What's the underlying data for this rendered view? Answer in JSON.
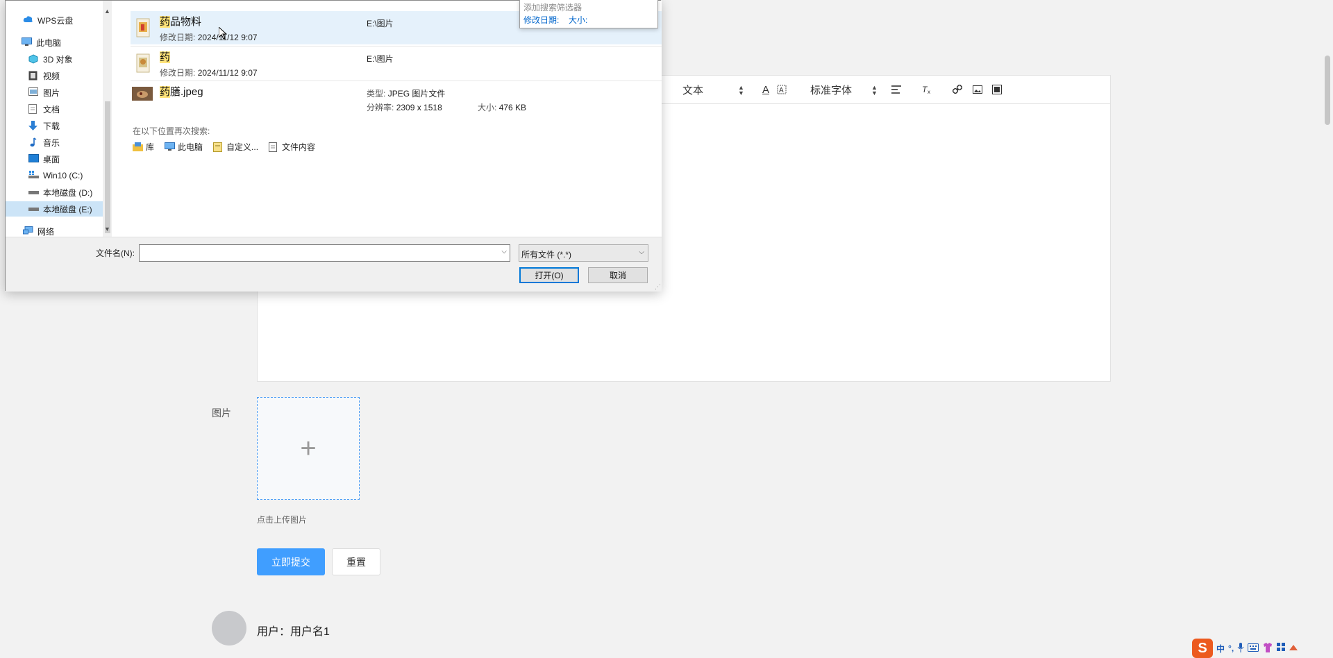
{
  "editor": {
    "toolbar": {
      "text_style": "文本",
      "font_color_icon": "A",
      "font_family": "标准字体"
    }
  },
  "form": {
    "image_label": "图片",
    "upload_plus": "+",
    "upload_hint": "点击上传图片",
    "submit_label": "立即提交",
    "reset_label": "重置"
  },
  "user": {
    "label": "用户：用户名1"
  },
  "dialog": {
    "nav": [
      {
        "label": "WPS云盘",
        "icon": "cloud-icon"
      },
      {
        "label": "此电脑",
        "icon": "computer-icon"
      },
      {
        "label": "3D 对象",
        "icon": "cube-icon"
      },
      {
        "label": "视频",
        "icon": "video-icon"
      },
      {
        "label": "图片",
        "icon": "picture-icon"
      },
      {
        "label": "文档",
        "icon": "document-icon"
      },
      {
        "label": "下载",
        "icon": "download-icon"
      },
      {
        "label": "音乐",
        "icon": "music-icon"
      },
      {
        "label": "桌面",
        "icon": "desktop-icon"
      },
      {
        "label": "Win10 (C:)",
        "icon": "drive-icon"
      },
      {
        "label": "本地磁盘 (D:)",
        "icon": "drive-icon"
      },
      {
        "label": "本地磁盘 (E:)",
        "icon": "drive-icon"
      },
      {
        "label": "网络",
        "icon": "network-icon"
      }
    ],
    "results": [
      {
        "name_highlight": "药",
        "name_rest": "品物料",
        "meta_label": "修改日期:",
        "meta_value": "2024/11/12 9:07",
        "path": "E:\\图片"
      },
      {
        "name_highlight": "药",
        "name_rest": "",
        "meta_label": "修改日期:",
        "meta_value": "2024/11/12 9:07",
        "path": "E:\\图片"
      },
      {
        "name_highlight": "药",
        "name_rest": "膳.jpeg",
        "type_label": "类型:",
        "type_value": "JPEG 图片文件",
        "res_label": "分辨率:",
        "res_value": "2309 x 1518",
        "size_label": "大小:",
        "size_value": "476 KB"
      }
    ],
    "research_title": "在以下位置再次搜索:",
    "research_links": [
      {
        "label": "库",
        "icon": "library-icon"
      },
      {
        "label": "此电脑",
        "icon": "computer-icon"
      },
      {
        "label": "自定义...",
        "icon": "custom-folder-icon"
      },
      {
        "label": "文件内容",
        "icon": "file-content-icon"
      }
    ],
    "filter_popup": {
      "title": "添加搜索筛选器",
      "date": "修改日期:",
      "size": "大小:"
    },
    "filename_label": "文件名(N):",
    "filename_value": "",
    "filetype": "所有文件 (*.*)",
    "open_label": "打开(O)",
    "cancel_label": "取消"
  },
  "tray": {
    "ime_logo": "S",
    "ime_mode": "中"
  },
  "colors": {
    "accent": "#409eff",
    "highlight": "#ffe37a",
    "selection": "#cce4f7",
    "hover": "#e5f1fb"
  }
}
